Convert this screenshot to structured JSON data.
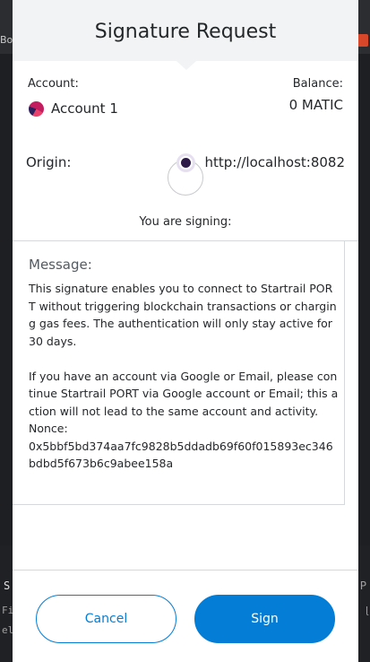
{
  "background": {
    "top_left_text": "Bo",
    "bottom_line_1": "S",
    "bottom_line_2": "Fil",
    "bottom_line_3": "el",
    "bottom_right_1": "P",
    "bottom_right_2": "ɭ"
  },
  "header": {
    "title": "Signature Request"
  },
  "account": {
    "label": "Account:",
    "name": "Account 1",
    "balance_label": "Balance:",
    "balance_value": "0 MATIC"
  },
  "origin": {
    "label": "Origin:",
    "url": "http://localhost:8082"
  },
  "signing_label": "You are signing:",
  "message": {
    "label": "Message:",
    "body": "This signature enables you to connect to Startrail PORT without triggering blockchain transactions or charging gas fees. The authentication will only stay active for 30 days.\n\nIf you have an account via Google or Email, please continue Startrail PORT via Google account or Email; this action will not lead to the same account and activity.\nNonce:\n0x5bbf5bd374aa7fc9828b5ddadb69f60f015893ec346bdbd5f673b6c9abee158a"
  },
  "buttons": {
    "cancel": "Cancel",
    "sign": "Sign"
  },
  "colors": {
    "primary": "#037dd6",
    "header_bg": "#f2f3f4",
    "text": "#24272a"
  }
}
